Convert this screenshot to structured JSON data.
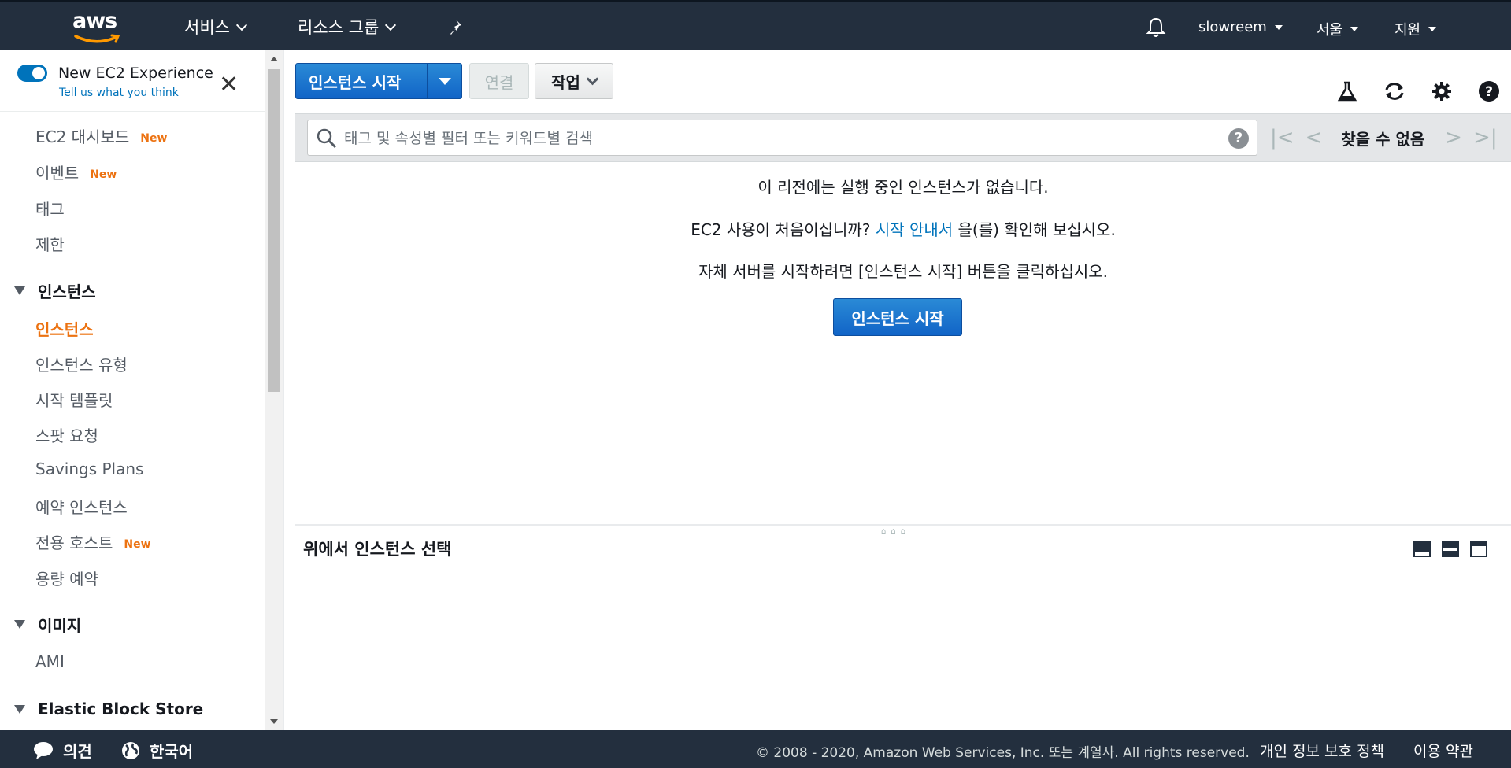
{
  "topnav": {
    "logo": "aws",
    "services": "서비스",
    "resource_groups": "리소스 그룹",
    "account": "slowreem",
    "region": "서울",
    "support": "지원",
    "icons": [
      "pin-icon",
      "bell-icon"
    ],
    "background": "#232f3e"
  },
  "sidebar": {
    "new_experience": {
      "title": "New EC2 Experience",
      "link": "Tell us what you think",
      "enabled": true
    },
    "badge_new": "New",
    "items": [
      {
        "label": "EC2 대시보드",
        "badge": "New"
      },
      {
        "label": "이벤트",
        "badge": "New"
      },
      {
        "label": "태그"
      },
      {
        "label": "제한"
      }
    ],
    "instances_section": "인스턴스",
    "instances_items": [
      {
        "label": "인스턴스",
        "active": true
      },
      {
        "label": "인스턴스 유형"
      },
      {
        "label": "시작 템플릿"
      },
      {
        "label": "스팟 요청"
      },
      {
        "label": "Savings Plans"
      },
      {
        "label": "예약 인스턴스"
      },
      {
        "label": "전용 호스트",
        "badge": "New"
      },
      {
        "label": "용량 예약"
      }
    ],
    "images_section": "이미지",
    "images_items": [
      {
        "label": "AMI"
      }
    ],
    "ebs_section": "Elastic Block Store"
  },
  "toolbar": {
    "launch_label": "인스턴스 시작",
    "connect_label": "연결",
    "actions_label": "작업",
    "icons": [
      "flask-icon",
      "refresh-icon",
      "gear-icon",
      "help-icon"
    ]
  },
  "filter": {
    "placeholder": "태그 및 속성별 필터 또는 키워드별 검색",
    "value": "",
    "pager_status": "찾을 수 없음"
  },
  "empty": {
    "line1": "이 리전에는 실행 중인 인스턴스가 없습니다.",
    "line2_prefix": "EC2 사용이 처음이십니까?",
    "line2_link": "시작 안내서",
    "line2_suffix": "을(를) 확인해 보십시오.",
    "line3": "자체 서버를 시작하려면 [인스턴스 시작] 버튼을 클릭하십시오.",
    "launch_button": "인스턴스 시작"
  },
  "details": {
    "title": "위에서 인스턴스 선택"
  },
  "footer": {
    "feedback": "의견",
    "language": "한국어",
    "copyright": "© 2008 - 2020, Amazon Web Services, Inc. 또는 계열사. All rights reserved.",
    "privacy": "개인 정보 보호 정책",
    "terms": "이용 약관"
  },
  "colors": {
    "accent": "#ec7211",
    "link": "#0073bb",
    "primary_button": "#1a76d2",
    "footer": "#232f3e"
  }
}
